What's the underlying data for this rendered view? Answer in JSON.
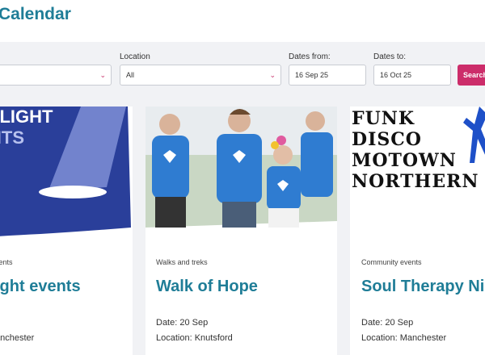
{
  "header": {
    "title": "Calendar"
  },
  "filters": {
    "category": {
      "value": ""
    },
    "location": {
      "label": "Location",
      "value": "All"
    },
    "date_from": {
      "label": "Dates from:",
      "value": "16 Sep 25"
    },
    "date_to": {
      "label": "Dates to:",
      "value": "16 Oct 25"
    },
    "search_label": "Search"
  },
  "cards": [
    {
      "image_text": [
        "TLIGHT",
        "NTS"
      ],
      "category": "vents",
      "title": "ight events",
      "date": "",
      "location": "anchester"
    },
    {
      "category": "Walks and treks",
      "title": "Walk of Hope",
      "date": "Date: 20 Sep",
      "location": "Location: Knutsford"
    },
    {
      "image_text": [
        "FUNK",
        "DISCO",
        "MOTOWN",
        "NORTHERN"
      ],
      "category": "Community events",
      "title": "Soul Therapy Nig",
      "date": "Date: 20 Sep",
      "location": "Location: Manchester"
    }
  ],
  "colors": {
    "brand_teal": "#1f7d97",
    "brand_pink": "#cc2d6a",
    "navy": "#2a3f9a"
  }
}
